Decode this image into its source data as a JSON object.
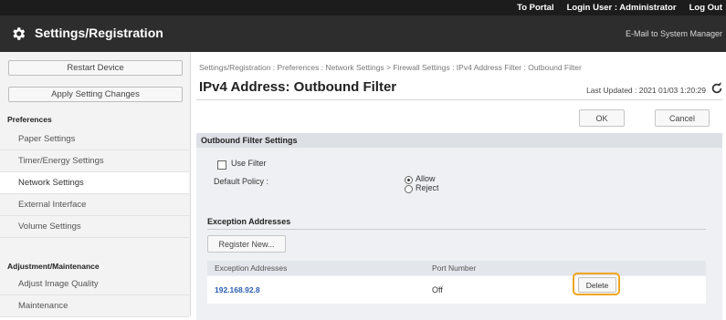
{
  "topbar": {
    "portal": "To Portal",
    "login_user": "Login User : Administrator",
    "logout": "Log Out",
    "email": "E-Mail to System Manager"
  },
  "header": {
    "title": "Settings/Registration",
    "icon": "gear-icon"
  },
  "sidebar": {
    "restart": "Restart Device",
    "apply": "Apply Setting Changes",
    "section_preferences": "Preferences",
    "items": [
      {
        "label": "Paper Settings"
      },
      {
        "label": "Timer/Energy Settings"
      },
      {
        "label": "Network Settings",
        "active": true
      },
      {
        "label": "External Interface"
      },
      {
        "label": "Volume Settings"
      }
    ],
    "section_adjust": "Adjustment/Maintenance",
    "adjust_items": [
      {
        "label": "Adjust Image Quality"
      },
      {
        "label": "Maintenance"
      }
    ]
  },
  "main": {
    "breadcrumb": "Settings/Registration : Preferences : Network Settings > Firewall Settings : IPv4 Address Filter : Outbound Filter",
    "title": "IPv4 Address: Outbound Filter",
    "last_updated": "Last Updated : 2021 01/03 1:20:29",
    "ok": "OK",
    "cancel": "Cancel",
    "section_title": "Outbound Filter Settings",
    "use_filter": "Use Filter",
    "default_policy_label": "Default Policy :",
    "policy_allow": "Allow",
    "policy_reject": "Reject",
    "exception_title": "Exception Addresses",
    "register_new": "Register New...",
    "table": {
      "col_address": "Exception Addresses",
      "col_port": "Port Number",
      "rows": [
        {
          "address": "192.168.92.8",
          "port": "Off",
          "action": "Delete"
        }
      ]
    }
  }
}
